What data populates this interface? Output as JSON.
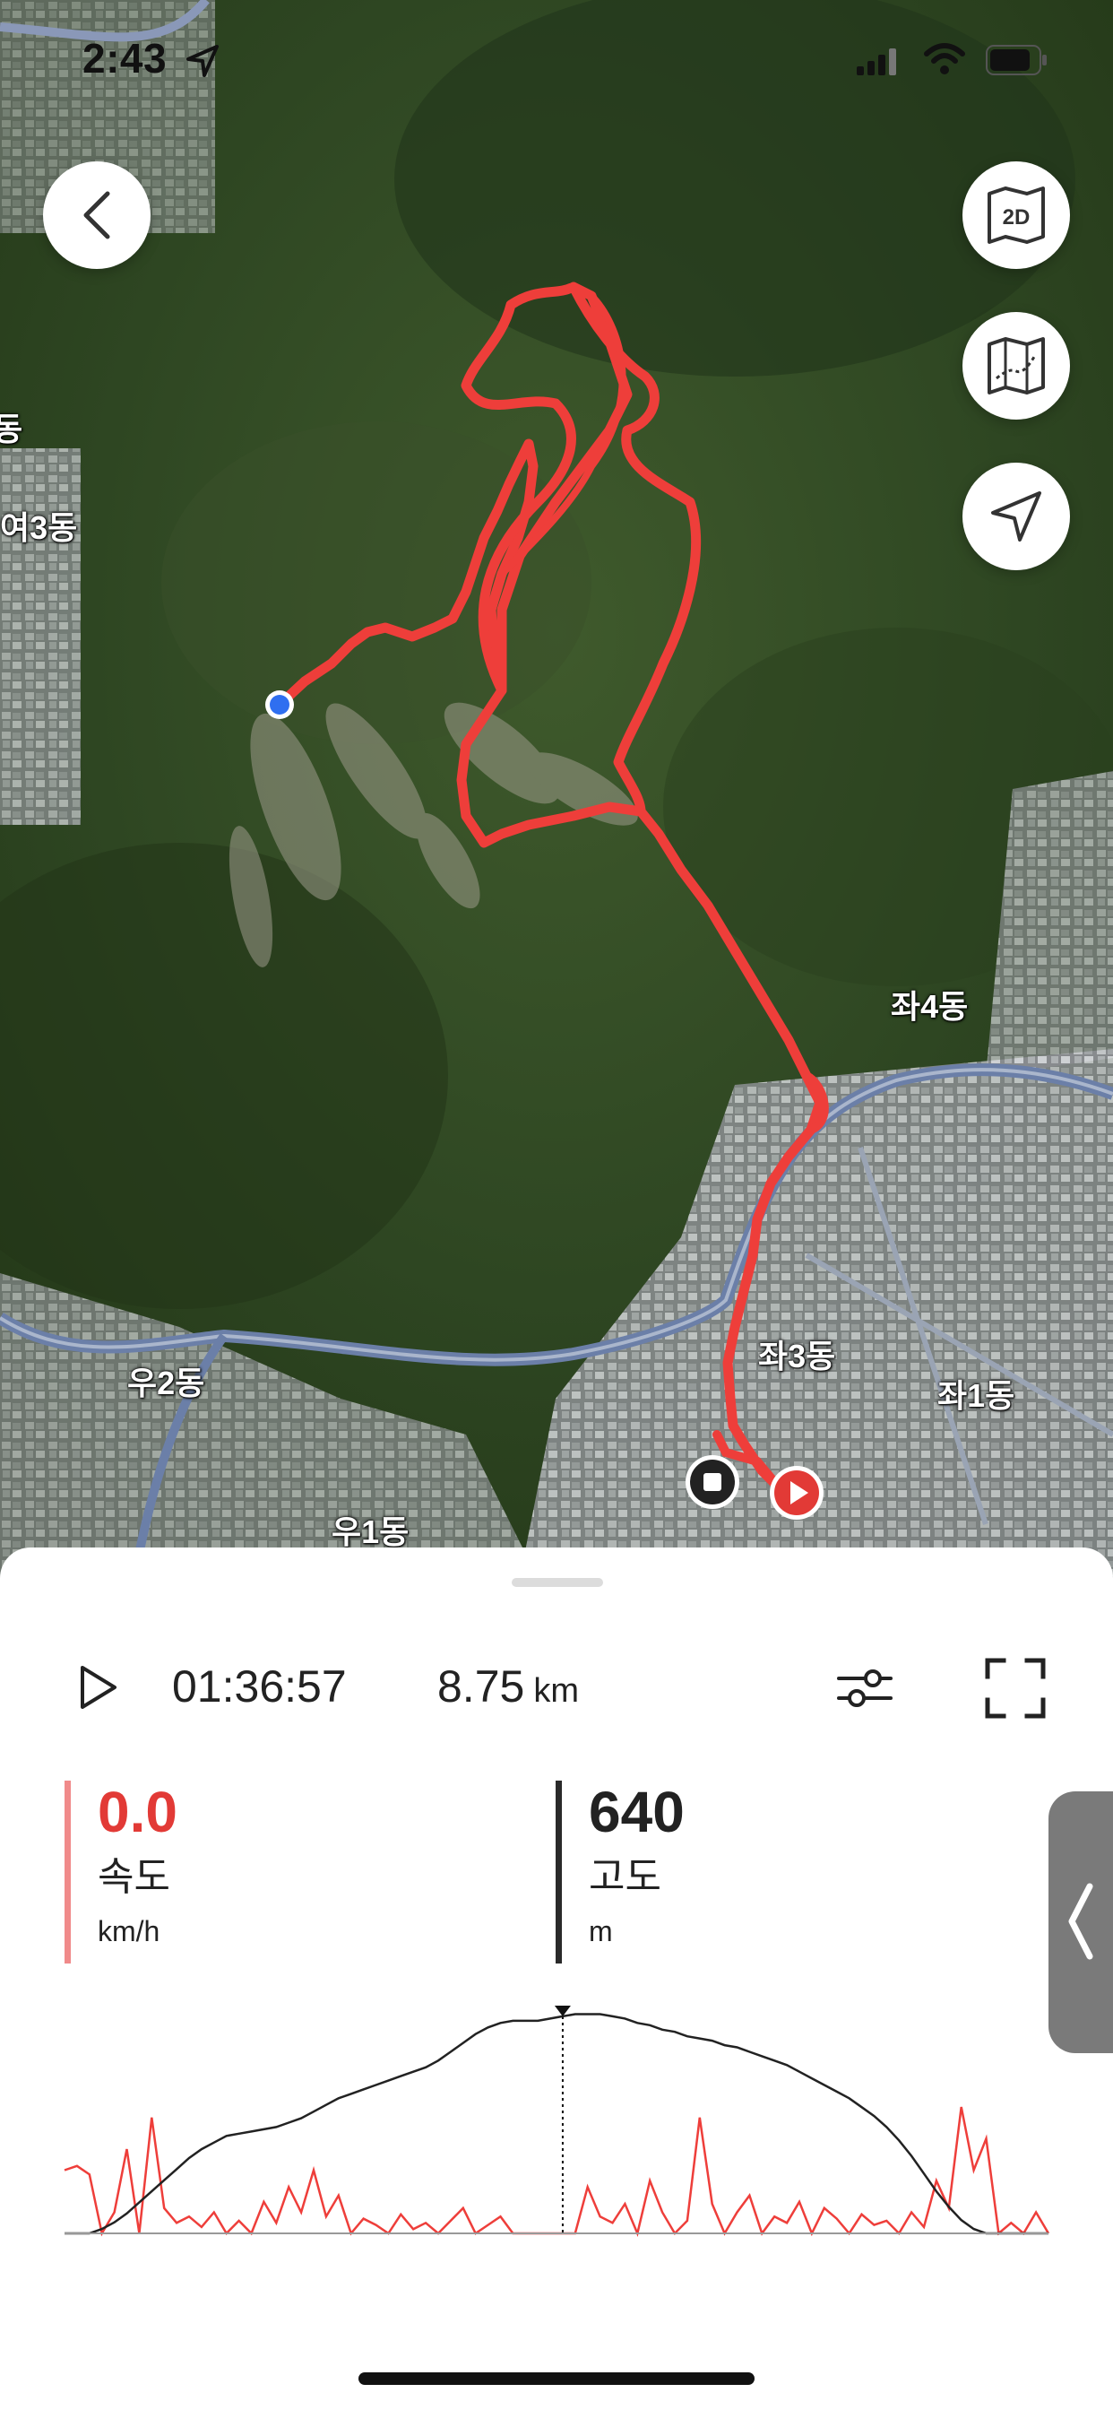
{
  "status_bar": {
    "time": "2:43"
  },
  "map": {
    "mode_label": "2D",
    "place_labels": [
      {
        "text": "여3동"
      },
      {
        "text": "좌4동"
      },
      {
        "text": "좌3동"
      },
      {
        "text": "좌1동"
      },
      {
        "text": "우2동"
      },
      {
        "text": "우1동"
      },
      {
        "text": "동"
      }
    ]
  },
  "playback": {
    "elapsed": "01:36:57",
    "distance_value": "8.75",
    "distance_unit": "km"
  },
  "metrics": {
    "speed": {
      "value": "0.0",
      "label": "속도",
      "unit": "km/h"
    },
    "altitude": {
      "value": "640",
      "label": "고도",
      "unit": "m"
    }
  },
  "colors": {
    "route": "#ee3e3a",
    "speed_accent": "#e23a36",
    "start_marker": "#2f6ff0",
    "speed_bar": "#f08a8a",
    "altitude_bar": "#2a2a2a"
  },
  "icons": [
    "back-icon",
    "map-2d-icon",
    "trail-map-icon",
    "locate-icon",
    "play-icon",
    "filter-icon",
    "fullscreen-icon",
    "chevron-left-icon",
    "stop-icon"
  ],
  "chart_data": {
    "type": "line",
    "title": "",
    "xlabel": "",
    "ylabel": "",
    "series": [
      {
        "values": [
          0,
          0,
          0,
          2,
          5,
          9,
          14,
          19,
          24,
          29,
          34,
          38,
          41,
          44,
          45,
          46,
          47,
          48,
          50,
          52,
          55,
          58,
          61,
          63,
          65,
          67,
          69,
          71,
          73,
          75,
          78,
          82,
          86,
          90,
          93,
          95,
          96,
          96,
          96,
          97,
          98,
          99,
          99,
          99,
          98,
          97,
          95,
          94,
          92,
          91,
          89,
          88,
          87,
          85,
          84,
          82,
          80,
          78,
          76,
          73,
          70,
          67,
          64,
          61,
          57,
          53,
          48,
          42,
          35,
          27,
          19,
          12,
          6,
          2,
          0,
          0,
          0,
          0,
          0,
          0
        ]
      },
      {
        "values": [
          30,
          32,
          28,
          0,
          10,
          40,
          0,
          55,
          12,
          5,
          8,
          3,
          10,
          0,
          6,
          0,
          15,
          5,
          22,
          10,
          30,
          8,
          18,
          0,
          7,
          4,
          0,
          9,
          2,
          5,
          0,
          6,
          12,
          0,
          4,
          8,
          0,
          0,
          0,
          0,
          0,
          0,
          22,
          8,
          5,
          14,
          0,
          25,
          10,
          0,
          6,
          55,
          14,
          0,
          10,
          18,
          0,
          8,
          5,
          15,
          0,
          12,
          7,
          0,
          9,
          4,
          6,
          0,
          10,
          3,
          25,
          12,
          60,
          30,
          45,
          0,
          5,
          0,
          10,
          0
        ]
      }
    ],
    "marker_index": 40
  }
}
